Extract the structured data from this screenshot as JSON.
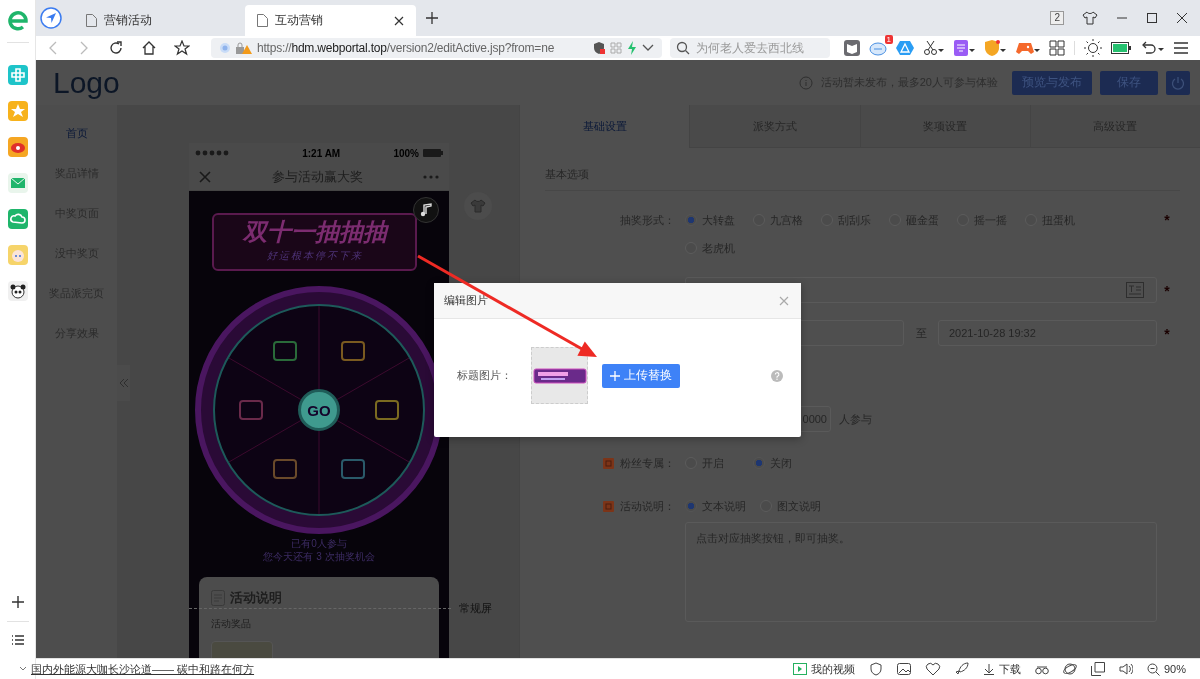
{
  "browser": {
    "tabs": [
      {
        "title": "营销活动",
        "selected": false
      },
      {
        "title": "互动营销",
        "selected": true
      }
    ],
    "tab_count": "2",
    "address": "https://**hdm.webportal.top**/version2/editActive.jsp?from=ne",
    "search": {
      "placeholder": "为何老人爱去西北线"
    },
    "extension_badge": "1"
  },
  "header": {
    "logo": "Logo",
    "notice": "活动暂未发布，最多20人可参与体验",
    "buttons": [
      "预览与发布",
      "保存"
    ]
  },
  "nav": [
    {
      "label": "首页",
      "selected": true
    },
    {
      "label": "奖品详情",
      "selected": false
    },
    {
      "label": "中奖页面",
      "selected": false
    },
    {
      "label": "没中奖页",
      "selected": false
    },
    {
      "label": "奖品派完页",
      "selected": false
    },
    {
      "label": "分享效果",
      "selected": false
    }
  ],
  "phone": {
    "time": "1:21 AM",
    "battery": "100%",
    "title": "参与活动赢大奖",
    "banner_title": "双十一抽抽抽",
    "banner_subtitle": "好运根本停不下来",
    "wheel_button": "GO",
    "stats": [
      "已有0人参与",
      "您今天还有 3 次抽奖机会"
    ],
    "card_title": "活动说明",
    "card_subtitle": "活动奖品"
  },
  "screen_label": "常规屏",
  "settings": {
    "tabs": [
      {
        "label": "基础设置",
        "selected": true
      },
      {
        "label": "派奖方式",
        "selected": false
      },
      {
        "label": "奖项设置",
        "selected": false
      },
      {
        "label": "高级设置",
        "selected": false
      }
    ],
    "section": "基本选项",
    "rows": [
      {
        "kind": "radio",
        "label": "抽奖形式：",
        "tagged": false,
        "required_mark": "*",
        "options": [
          {
            "label": "大转盘",
            "selected": true
          },
          {
            "label": "九宫格",
            "selected": false
          },
          {
            "label": "刮刮乐",
            "selected": false
          },
          {
            "label": "砸金蛋",
            "selected": false
          },
          {
            "label": "摇一摇",
            "selected": false
          },
          {
            "label": "扭蛋机",
            "selected": false
          },
          {
            "label": "老虎机",
            "selected": false
          }
        ]
      },
      {
        "kind": "field",
        "required_mark": "*"
      },
      {
        "kind": "daterange",
        "separator": "至",
        "end": "2021-10-28 19:32",
        "required_mark": "*"
      },
      {
        "kind": "count",
        "value": "0000",
        "suffix": "人参与"
      },
      {
        "kind": "radio",
        "label": "粉丝专属：",
        "tagged": true,
        "options": [
          {
            "label": "开启",
            "selected": false
          },
          {
            "label": "关闭",
            "selected": true
          }
        ]
      },
      {
        "kind": "radio",
        "label": "活动说明：",
        "tagged": true,
        "options": [
          {
            "label": "文本说明",
            "selected": true
          },
          {
            "label": "图文说明",
            "selected": false
          }
        ],
        "text_area": "点击对应抽奖按钮，即可抽奖。"
      }
    ]
  },
  "modal": {
    "title": "编辑图片",
    "label": "标题图片：",
    "button": "上传替换"
  },
  "status_bar": {
    "headline": "国内外能源大咖长沙论道—— 碳中和路在何方",
    "video": "我的视频",
    "download": "下载",
    "zoom": "90%"
  }
}
